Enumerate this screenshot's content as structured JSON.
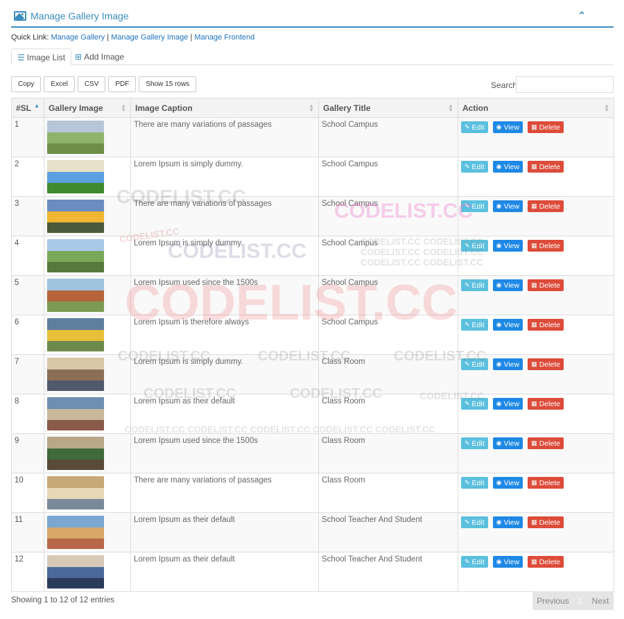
{
  "header": {
    "title": "Manage Gallery Image",
    "collapse_icon": "chevron-up-icon"
  },
  "quick_links": {
    "label": "Quick Link:",
    "links": [
      "Manage Gallery",
      "Manage Gallery Image",
      "Manage Frontend"
    ],
    "separator": "|"
  },
  "tabs": [
    {
      "label": "Image List",
      "icon": "list-icon"
    },
    {
      "label": "Add Image",
      "icon": "plus-square-icon"
    }
  ],
  "export_buttons": [
    "Copy",
    "Excel",
    "CSV",
    "PDF",
    "Show 15 rows"
  ],
  "search": {
    "label": "Search:",
    "value": ""
  },
  "table": {
    "columns": [
      "#SL",
      "Gallery Image",
      "Image Caption",
      "Gallery Title",
      "Action"
    ],
    "actions": {
      "edit": "Edit",
      "view": "View",
      "delete": "Delete"
    },
    "rows": [
      {
        "sl": "1",
        "caption": "There are many variations of passages",
        "title": "School Campus"
      },
      {
        "sl": "2",
        "caption": "Lorem Ipsum is simply dummy.",
        "title": "School Campus"
      },
      {
        "sl": "3",
        "caption": "There are many variations of passages",
        "title": "School Campus"
      },
      {
        "sl": "4",
        "caption": "Lorem Ipsum is simply dummy.",
        "title": "School Campus"
      },
      {
        "sl": "5",
        "caption": "Lorem Ipsum used since the 1500s",
        "title": "School Campus"
      },
      {
        "sl": "6",
        "caption": "Lorem Ipsum is therefore always",
        "title": "School Campus"
      },
      {
        "sl": "7",
        "caption": "Lorem Ipsum is simply dummy.",
        "title": "Class Room"
      },
      {
        "sl": "8",
        "caption": "Lorem Ipsum as their default",
        "title": "Class Room"
      },
      {
        "sl": "9",
        "caption": "Lorem Ipsum used since the 1500s",
        "title": "Class Room"
      },
      {
        "sl": "10",
        "caption": "There are many variations of passages",
        "title": "Class Room"
      },
      {
        "sl": "11",
        "caption": "Lorem Ipsum as their default",
        "title": "School Teacher And Student"
      },
      {
        "sl": "12",
        "caption": "Lorem Ipsum as their default",
        "title": "School Teacher And Student"
      }
    ]
  },
  "footer": {
    "info": "Showing 1 to 12 of 12 entries",
    "previous": "Previous",
    "current_page": "1",
    "next": "Next"
  },
  "colors": {
    "accent": "#3c8dbc",
    "edit": "#5bc0de",
    "view": "#1e88e5",
    "delete": "#dd4b39"
  },
  "watermark": "CODELIST.CC"
}
